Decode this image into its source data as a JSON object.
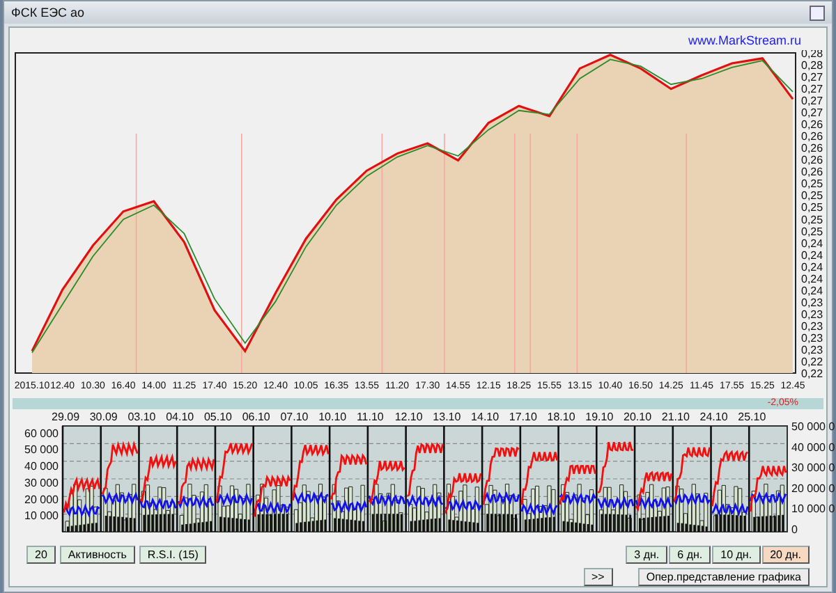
{
  "window": {
    "title": "ФСК ЕЭС ао"
  },
  "link": "www.MarkStream.ru",
  "price_chart": {
    "chart_data": {
      "type": "area",
      "grid": true,
      "categories": [
        "2015.10",
        "12.40",
        "10.30",
        "16.40",
        "14.00",
        "11.25",
        "17.40",
        "15.20",
        "12.40",
        "10.05",
        "16.35",
        "13.55",
        "11.20",
        "17.30",
        "14.55",
        "12.15",
        "18.25",
        "15.55",
        "13.15",
        "10.40",
        "16.50",
        "14.25",
        "11.45",
        "17.55",
        "15.25",
        "12.45"
      ],
      "series": [
        {
          "color": "#e01010",
          "values": [
            0.2248,
            0.2356,
            0.2434,
            0.2494,
            0.2512,
            0.244,
            0.232,
            0.2248,
            0.235,
            0.2446,
            0.2515,
            0.2566,
            0.2596,
            0.2614,
            0.2584,
            0.265,
            0.268,
            0.2662,
            0.2746,
            0.277,
            0.2746,
            0.271,
            0.2734,
            0.2755,
            0.2764,
            0.2692
          ]
        },
        {
          "type": "line",
          "color": "#2a8a2a",
          "values": [
            0.2245,
            0.233,
            0.2415,
            0.248,
            0.2505,
            0.2455,
            0.234,
            0.2262,
            0.2335,
            0.2432,
            0.2505,
            0.2556,
            0.259,
            0.261,
            0.2592,
            0.2638,
            0.2672,
            0.2665,
            0.2728,
            0.2762,
            0.275,
            0.2718,
            0.2728,
            0.2748,
            0.276,
            0.2705
          ]
        }
      ],
      "ylim": [
        0.22092,
        0.27735
      ],
      "yticks": [
        {
          "value": 0.22092,
          "label": "0,22"
        },
        {
          "value": 0.22301,
          "label": "0,22"
        },
        {
          "value": 0.2251,
          "label": "0,23"
        },
        {
          "value": 0.22719,
          "label": "0,23"
        },
        {
          "value": 0.22928,
          "label": "0,23"
        },
        {
          "value": 0.23137,
          "label": "0,23"
        },
        {
          "value": 0.23346,
          "label": "0,23"
        },
        {
          "value": 0.23555,
          "label": "0,24"
        },
        {
          "value": 0.23764,
          "label": "0,24"
        },
        {
          "value": 0.23973,
          "label": "0,24"
        },
        {
          "value": 0.24182,
          "label": "0,24"
        },
        {
          "value": 0.24391,
          "label": "0,24"
        },
        {
          "value": 0.246,
          "label": "0,25"
        },
        {
          "value": 0.24809,
          "label": "0,25"
        },
        {
          "value": 0.25018,
          "label": "0,25"
        },
        {
          "value": 0.25227,
          "label": "0,25"
        },
        {
          "value": 0.25436,
          "label": "0,25"
        },
        {
          "value": 0.25645,
          "label": "0,26"
        },
        {
          "value": 0.25854,
          "label": "0,26"
        },
        {
          "value": 0.26063,
          "label": "0,26"
        },
        {
          "value": 0.26272,
          "label": "0,26"
        },
        {
          "value": 0.26481,
          "label": "0,26"
        },
        {
          "value": 0.2669,
          "label": "0,27"
        },
        {
          "value": 0.26899,
          "label": "0,27"
        },
        {
          "value": 0.27108,
          "label": "0,27"
        },
        {
          "value": 0.27317,
          "label": "0,27"
        },
        {
          "value": 0.27526,
          "label": "0,28"
        },
        {
          "value": 0.27735,
          "label": "0,28"
        }
      ]
    }
  },
  "change": "-2,05%",
  "volume_chart": {
    "date_labels": [
      "29.09",
      "30.09",
      "03.10",
      "04.10",
      "05.10",
      "06.10",
      "07.10",
      "10.10",
      "11.10",
      "12.10",
      "13.10",
      "14.10",
      "17.10",
      "18.10",
      "19.10",
      "20.10",
      "21.10",
      "24.10",
      "25.10"
    ],
    "left_labels": [
      "60 000",
      "50 000",
      "40 000",
      "30 000",
      "20 000",
      "10 000"
    ],
    "right_labels": [
      "50 000 0",
      "40 000 0",
      "30 000 0",
      "20 000 0",
      "10 000 0",
      "0"
    ]
  },
  "left_buttons": [
    "20",
    "Активность",
    "R.S.I.  (15)"
  ],
  "period_buttons": [
    {
      "label": "3 дн.",
      "selected": false
    },
    {
      "label": "6 дн.",
      "selected": false
    },
    {
      "label": "10 дн.",
      "selected": false
    },
    {
      "label": "20 дн.",
      "selected": true
    }
  ],
  "scroll_button": ">>",
  "mode_button": "Опер.представление графика"
}
